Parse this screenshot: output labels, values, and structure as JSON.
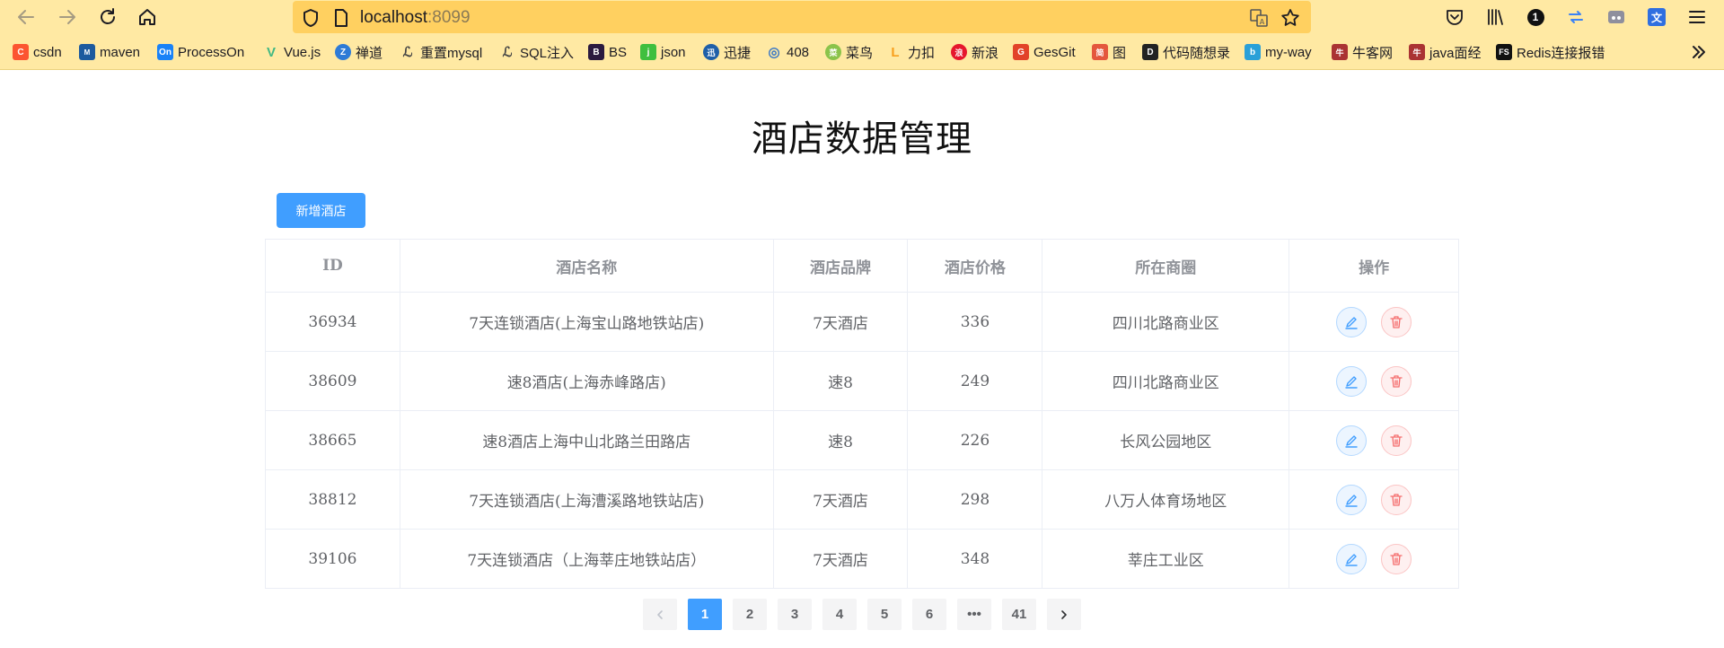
{
  "browser": {
    "url_host": "localhost",
    "url_port": ":8099",
    "bookmarks": [
      {
        "label": "csdn",
        "icon": "csdn-icon",
        "color": "#fc5531",
        "glyph": "C"
      },
      {
        "label": "maven",
        "icon": "maven-icon",
        "color": "#1d5a9e",
        "glyph": "M"
      },
      {
        "label": "ProcessOn",
        "icon": "processon-icon",
        "color": "#1a82f7",
        "glyph": "On"
      },
      {
        "label": "Vue.js",
        "icon": "vue-icon",
        "color": "#41b883",
        "glyph": "V"
      },
      {
        "label": "禅道",
        "icon": "zentao-icon",
        "color": "#2e7bd6",
        "glyph": "Z"
      },
      {
        "label": "重置mysql",
        "icon": "feather-icon",
        "color": "#444444",
        "glyph": "ℒ"
      },
      {
        "label": "SQL注入",
        "icon": "feather-icon",
        "color": "#444444",
        "glyph": "ℒ"
      },
      {
        "label": "BS",
        "icon": "bootstrap-icon",
        "color": "#2b1a3f",
        "glyph": "B"
      },
      {
        "label": "json",
        "icon": "json-icon",
        "color": "#3fbf3f",
        "glyph": "j"
      },
      {
        "label": "迅捷",
        "icon": "xunjie-icon",
        "color": "#1f5fa8",
        "glyph": "迅"
      },
      {
        "label": "408",
        "icon": "408-icon",
        "color": "#3a78c6",
        "glyph": "◎"
      },
      {
        "label": "菜鸟",
        "icon": "runoob-icon",
        "color": "#8bc34a",
        "glyph": "菜"
      },
      {
        "label": "力扣",
        "icon": "leetcode-icon",
        "color": "#f89f1b",
        "glyph": "L"
      },
      {
        "label": "新浪",
        "icon": "weibo-icon",
        "color": "#e6162d",
        "glyph": "浪"
      },
      {
        "label": "GesGit",
        "icon": "gitlab-icon",
        "color": "#e24329",
        "glyph": "G"
      },
      {
        "label": "图",
        "icon": "image-icon",
        "color": "#e4573d",
        "glyph": "简"
      },
      {
        "label": "代码随想录",
        "icon": "code-icon",
        "color": "#222222",
        "glyph": "D"
      },
      {
        "label": "my-way",
        "icon": "bilibili-icon",
        "color": "#2aa0d8",
        "glyph": "b"
      },
      {
        "label": "牛客网",
        "icon": "nowcoder-icon",
        "color": "#aa3333",
        "glyph": "牛"
      },
      {
        "label": "java面经",
        "icon": "nowcoder-icon",
        "color": "#aa3333",
        "glyph": "牛"
      },
      {
        "label": "Redis连接报错",
        "icon": "fs-icon",
        "color": "#111111",
        "glyph": "FS"
      }
    ],
    "colors": {
      "toolbar": "#ffe9a3",
      "urlbar": "#ffd060"
    }
  },
  "page": {
    "title": "酒店数据管理",
    "add_button_label": "新增酒店",
    "accent": "#409eff"
  },
  "table": {
    "columns": [
      "ID",
      "酒店名称",
      "酒店品牌",
      "酒店价格",
      "所在商圈",
      "操作"
    ],
    "rows": [
      {
        "id": "36934",
        "name": "7天连锁酒店(上海宝山路地铁站店)",
        "brand": "7天酒店",
        "price": "336",
        "area": "四川北路商业区"
      },
      {
        "id": "38609",
        "name": "速8酒店(上海赤峰路店)",
        "brand": "速8",
        "price": "249",
        "area": "四川北路商业区"
      },
      {
        "id": "38665",
        "name": "速8酒店上海中山北路兰田路店",
        "brand": "速8",
        "price": "226",
        "area": "长风公园地区"
      },
      {
        "id": "38812",
        "name": "7天连锁酒店(上海漕溪路地铁站店)",
        "brand": "7天酒店",
        "price": "298",
        "area": "八万人体育场地区"
      },
      {
        "id": "39106",
        "name": "7天连锁酒店（上海莘庄地铁站店）",
        "brand": "7天酒店",
        "price": "348",
        "area": "莘庄工业区"
      }
    ],
    "row_actions": [
      "edit-icon",
      "delete-icon"
    ]
  },
  "pagination": {
    "pages": [
      "1",
      "2",
      "3",
      "4",
      "5",
      "6",
      "•••",
      "41"
    ],
    "current": "1"
  }
}
